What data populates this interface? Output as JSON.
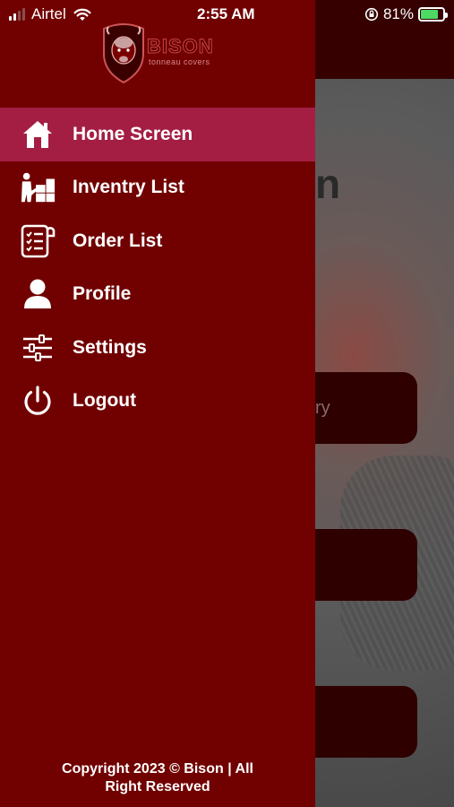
{
  "status_bar": {
    "carrier": "Airtel",
    "time": "2:55 AM",
    "battery_percent": "81%",
    "battery_level": 0.81,
    "icons": [
      "signal-icon",
      "wifi-icon",
      "orientation-lock-icon",
      "battery-charging-icon"
    ]
  },
  "drawer": {
    "logo": {
      "word": "BISON",
      "tagline": "tonneau covers"
    },
    "menu": [
      {
        "label": "Home Screen",
        "icon": "home-icon",
        "active": true
      },
      {
        "label": "Inventry List",
        "icon": "inventory-icon",
        "active": false
      },
      {
        "label": "Order List",
        "icon": "order-list-icon",
        "active": false
      },
      {
        "label": "Profile",
        "icon": "profile-icon",
        "active": false
      },
      {
        "label": "Settings",
        "icon": "settings-icon",
        "active": false
      },
      {
        "label": "Logout",
        "icon": "logout-icon",
        "active": false
      }
    ],
    "footer": {
      "line1": "Copyright 2023 © Bison | All",
      "line2": "Right Reserved"
    }
  },
  "background_screen": {
    "logo_fragment": "n",
    "button_fragment": "ry"
  },
  "colors": {
    "drawer": "#710000",
    "active_item": "#a41e44",
    "header": "#360000",
    "battery": "#4cd964"
  }
}
